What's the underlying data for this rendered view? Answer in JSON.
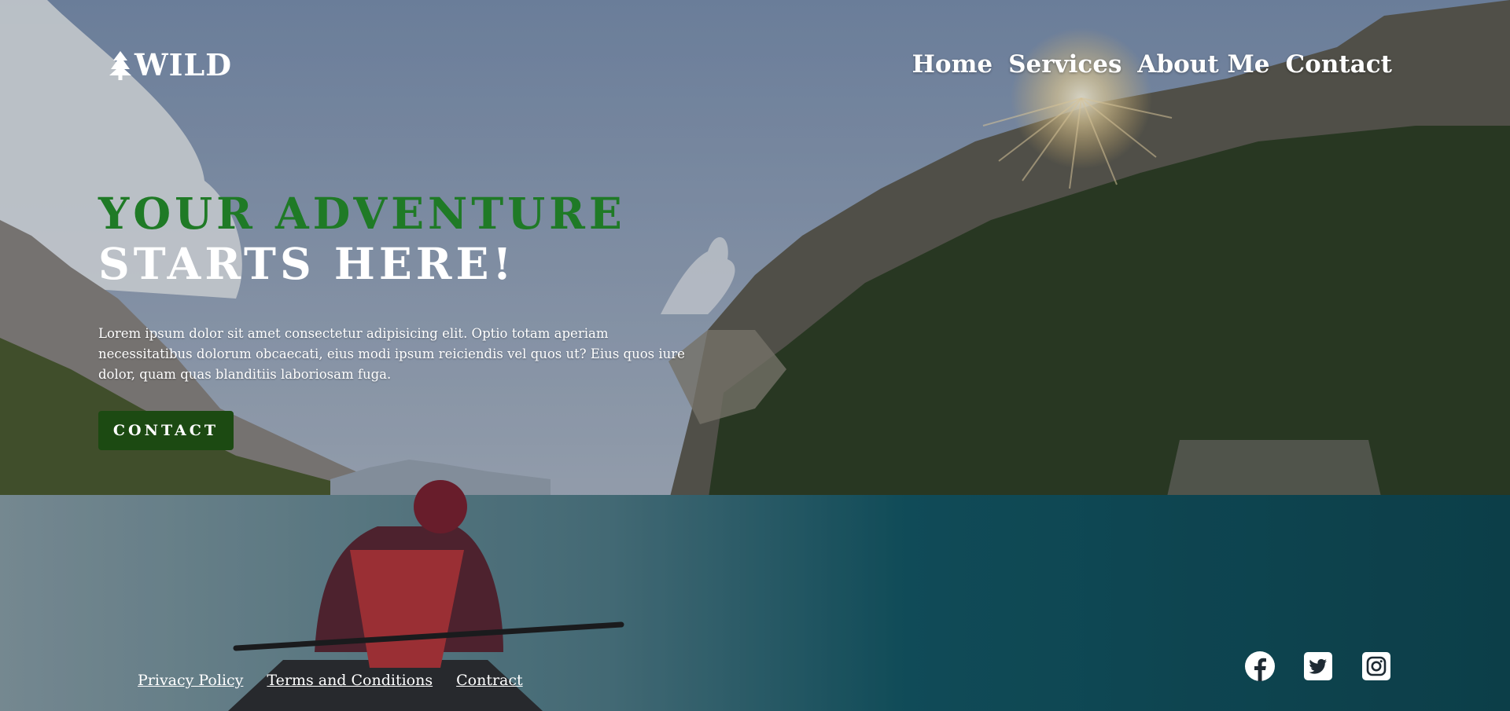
{
  "logo": {
    "text": "WILD",
    "icon": "tree-icon"
  },
  "nav": [
    {
      "label": "Home"
    },
    {
      "label": "Services"
    },
    {
      "label": "About Me"
    },
    {
      "label": "Contact"
    }
  ],
  "hero": {
    "title_line1": "YOUR ADVENTURE",
    "title_line2": "STARTS HERE!",
    "description": "Lorem ipsum dolor sit amet consectetur adipisicing elit. Optio totam aperiam necessitatibus dolorum obcaecati, eius modi ipsum reiciendis vel quos ut? Eius quos iure dolor, quam quas blanditiis laboriosam fuga.",
    "cta_label": "CONTACT"
  },
  "footer": {
    "links": [
      {
        "label": "Privacy Policy"
      },
      {
        "label": "Terms and Conditions"
      },
      {
        "label": "Contract"
      }
    ],
    "social": [
      {
        "icon": "facebook-icon"
      },
      {
        "icon": "twitter-icon"
      },
      {
        "icon": "instagram-icon"
      }
    ]
  },
  "colors": {
    "title_accent": "#1f7a26",
    "cta_background": "#1c4a12",
    "text": "#ffffff"
  }
}
